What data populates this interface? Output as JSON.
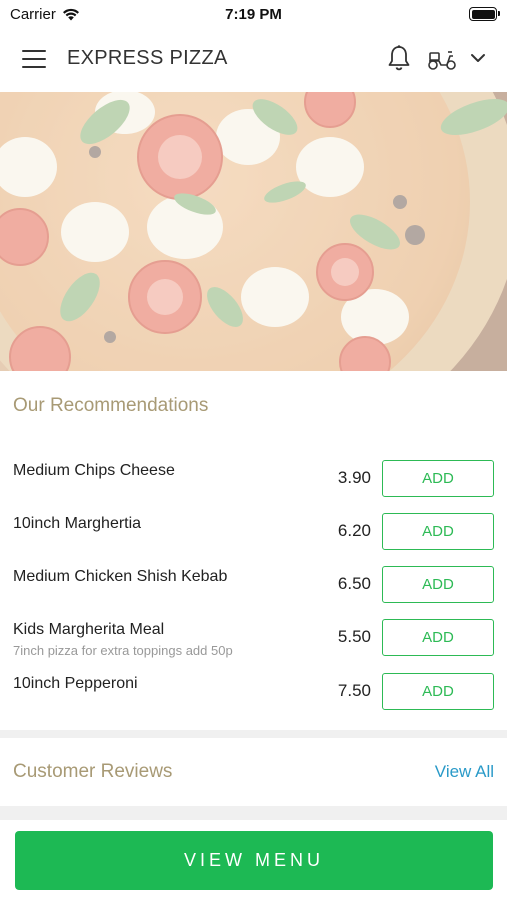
{
  "status_bar": {
    "carrier": "Carrier",
    "time": "7:19 PM"
  },
  "header": {
    "title": "EXPRESS PIZZA",
    "icons": [
      "menu-icon",
      "bell-icon",
      "scooter-icon",
      "chevron-down-icon"
    ]
  },
  "hero": {
    "alt": "pizza-hero-image"
  },
  "recommendations": {
    "title": "Our Recommendations",
    "add_label": "ADD",
    "items": [
      {
        "name": "Medium Chips Cheese",
        "description": "",
        "price": "3.90"
      },
      {
        "name": "10inch Marghertia",
        "description": "",
        "price": "6.20"
      },
      {
        "name": "Medium Chicken Shish Kebab",
        "description": "",
        "price": "6.50"
      },
      {
        "name": "Kids Margherita Meal",
        "description": "7inch pizza for extra toppings add 50p",
        "price": "5.50"
      },
      {
        "name": "10inch Pepperoni",
        "description": "",
        "price": "7.50"
      }
    ]
  },
  "reviews": {
    "title": "Customer Reviews",
    "view_all": "View All"
  },
  "footer": {
    "view_menu": "VIEW MENU"
  },
  "colors": {
    "accent_green": "#1db954",
    "section_title": "#a89a75",
    "link_blue": "#2a9ac8"
  }
}
